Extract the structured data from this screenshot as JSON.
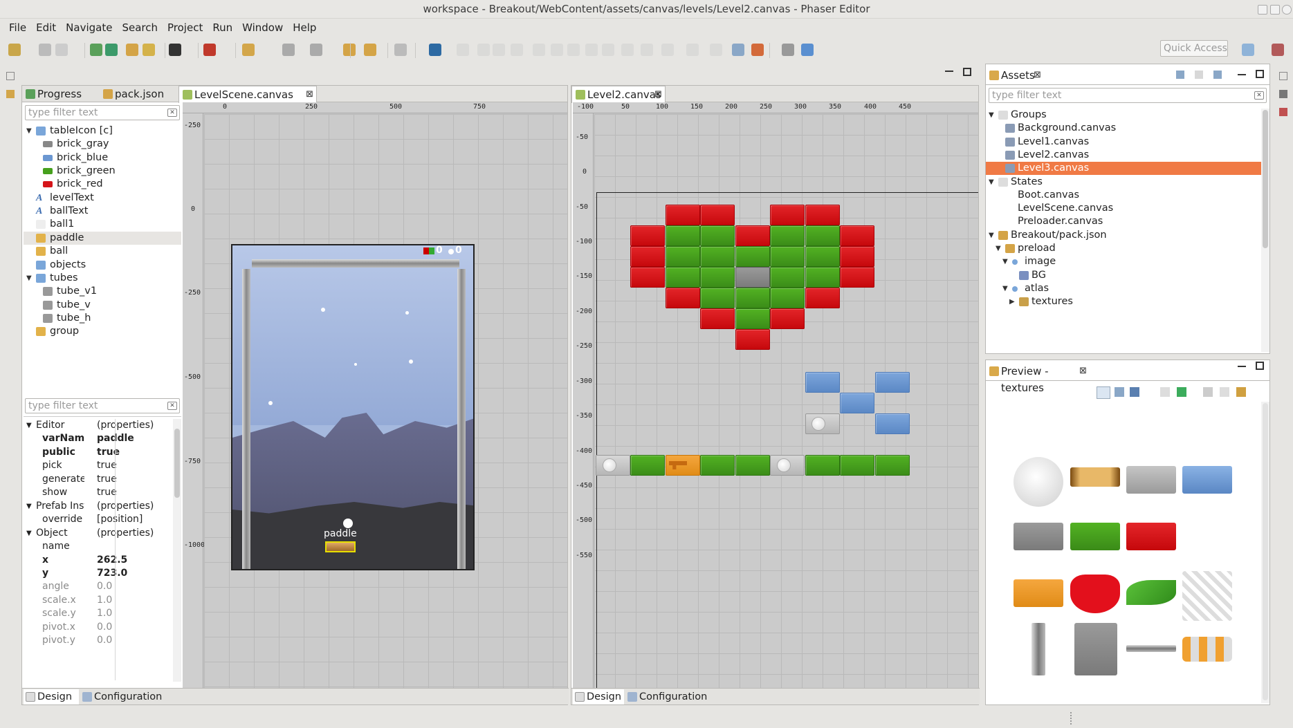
{
  "window": {
    "title": "workspace - Breakout/WebContent/assets/canvas/levels/Level2.canvas - Phaser Editor"
  },
  "menu": [
    "File",
    "Edit",
    "Navigate",
    "Search",
    "Project",
    "Run",
    "Window",
    "Help"
  ],
  "toolbar": {
    "quick_access": "Quick Access"
  },
  "left_panel": {
    "tabs": [
      {
        "label": "Progress",
        "icon": "progress-icon"
      },
      {
        "label": "pack.json",
        "icon": "pack-icon"
      },
      {
        "label": "LevelScene.canvas",
        "icon": "canvas-icon",
        "active": true
      }
    ],
    "filter_placeholder": "type filter text",
    "outline": [
      {
        "label": "tableIcon [c]",
        "icon": "group-icon",
        "level": 0,
        "expanded": true
      },
      {
        "label": "brick_gray",
        "icon": "sprite-gray-icon",
        "level": 1
      },
      {
        "label": "brick_blue",
        "icon": "sprite-blue-icon",
        "level": 1
      },
      {
        "label": "brick_green",
        "icon": "sprite-green-icon",
        "level": 1
      },
      {
        "label": "brick_red",
        "icon": "sprite-red-icon",
        "level": 1
      },
      {
        "label": "levelText",
        "icon": "text-icon",
        "level": 0
      },
      {
        "label": "ballText",
        "icon": "text-icon",
        "level": 0
      },
      {
        "label": "ball1",
        "icon": "ball-icon",
        "level": 0
      },
      {
        "label": "paddle",
        "icon": "prefab-icon",
        "level": 0,
        "selected": true
      },
      {
        "label": "ball",
        "icon": "prefab-icon",
        "level": 0
      },
      {
        "label": "objects",
        "icon": "group-icon",
        "level": 0
      },
      {
        "label": "tubes",
        "icon": "group-icon",
        "level": 0,
        "expanded": true
      },
      {
        "label": "tube_v1",
        "icon": "tube-icon",
        "level": 1
      },
      {
        "label": "tube_v",
        "icon": "tube-icon",
        "level": 1
      },
      {
        "label": "tube_h",
        "icon": "tube-icon",
        "level": 1
      },
      {
        "label": "group",
        "icon": "prefab-icon",
        "level": 0
      }
    ],
    "properties_filter_placeholder": "type filter text",
    "properties": [
      {
        "k": "Editor",
        "v": "(properties)",
        "cat": true
      },
      {
        "k": "varName",
        "v": "paddle",
        "bold": true
      },
      {
        "k": "public",
        "v": "true",
        "bold": true
      },
      {
        "k": "pick",
        "v": "true"
      },
      {
        "k": "generate",
        "v": "true"
      },
      {
        "k": "show",
        "v": "true"
      },
      {
        "k": "Prefab Insta",
        "v": "(properties)",
        "cat": true
      },
      {
        "k": "override",
        "v": "[position]"
      },
      {
        "k": "Object",
        "v": "(properties)",
        "cat": true
      },
      {
        "k": "name",
        "v": ""
      },
      {
        "k": "x",
        "v": "262.5",
        "bold": true
      },
      {
        "k": "y",
        "v": "723.0",
        "bold": true
      },
      {
        "k": "angle",
        "v": "0.0",
        "gray": true
      },
      {
        "k": "scale.x",
        "v": "1.0",
        "gray": true
      },
      {
        "k": "scale.y",
        "v": "1.0",
        "gray": true
      },
      {
        "k": "pivot.x",
        "v": "0.0",
        "gray": true
      },
      {
        "k": "pivot.y",
        "v": "0.0",
        "gray": true
      }
    ],
    "bottom_tabs": [
      "Design",
      "Configuration"
    ]
  },
  "level_scene": {
    "ruler_x": [
      "0",
      "250",
      "500",
      "750"
    ],
    "ruler_y": [
      "-250",
      "0",
      "-250",
      "-500",
      "-750",
      "-1000"
    ],
    "paddle_label": "paddle",
    "hud": [
      "0",
      "0"
    ]
  },
  "level2": {
    "tab_label": "Level2.canvas",
    "ruler_x": [
      "-100",
      "50",
      "100",
      "150",
      "200",
      "250",
      "300",
      "350",
      "400",
      "450"
    ],
    "ruler_y": [
      "-50",
      "0",
      "-50",
      "-100",
      "-150",
      "-200",
      "-250",
      "-300",
      "-350",
      "-400",
      "-450",
      "-500",
      "-550"
    ],
    "bottom_tabs": [
      "Design",
      "Configuration"
    ]
  },
  "assets": {
    "tab_label": "Assets",
    "filter_placeholder": "type filter text",
    "tree": [
      {
        "label": "Groups",
        "level": 0,
        "tw": "v",
        "icon": "folder-icon"
      },
      {
        "label": "Background.canvas",
        "level": 1,
        "icon": "canvas-file-icon"
      },
      {
        "label": "Level1.canvas",
        "level": 1,
        "icon": "canvas-file-icon"
      },
      {
        "label": "Level2.canvas",
        "level": 1,
        "icon": "canvas-file-icon"
      },
      {
        "label": "Level3.canvas",
        "level": 1,
        "icon": "canvas-file-icon",
        "highlight": true
      },
      {
        "label": "States",
        "level": 0,
        "tw": "v",
        "icon": "folder-icon"
      },
      {
        "label": "Boot.canvas",
        "level": 1,
        "icon": "none"
      },
      {
        "label": "LevelScene.canvas",
        "level": 1,
        "icon": "none"
      },
      {
        "label": "Preloader.canvas",
        "level": 1,
        "icon": "none"
      },
      {
        "label": "Breakout/pack.json",
        "level": 0,
        "tw": "v",
        "icon": "pack-icon"
      },
      {
        "label": "preload",
        "level": 1,
        "tw": "v",
        "icon": "pack-folder-icon"
      },
      {
        "label": "image",
        "level": 2,
        "tw": "v",
        "icon": "dot-icon"
      },
      {
        "label": "BG",
        "level": 3,
        "icon": "image-icon"
      },
      {
        "label": "atlas",
        "level": 2,
        "tw": "v",
        "icon": "dot-icon"
      },
      {
        "label": "textures",
        "level": 3,
        "tw": ">",
        "icon": "atlas-icon"
      }
    ]
  },
  "preview": {
    "tab_label": "Preview - textures"
  },
  "colors": {
    "highlight": "#f07a45",
    "brick_red": "#d5151a",
    "brick_green": "#46a01d",
    "brick_blue": "#6b97d1"
  }
}
